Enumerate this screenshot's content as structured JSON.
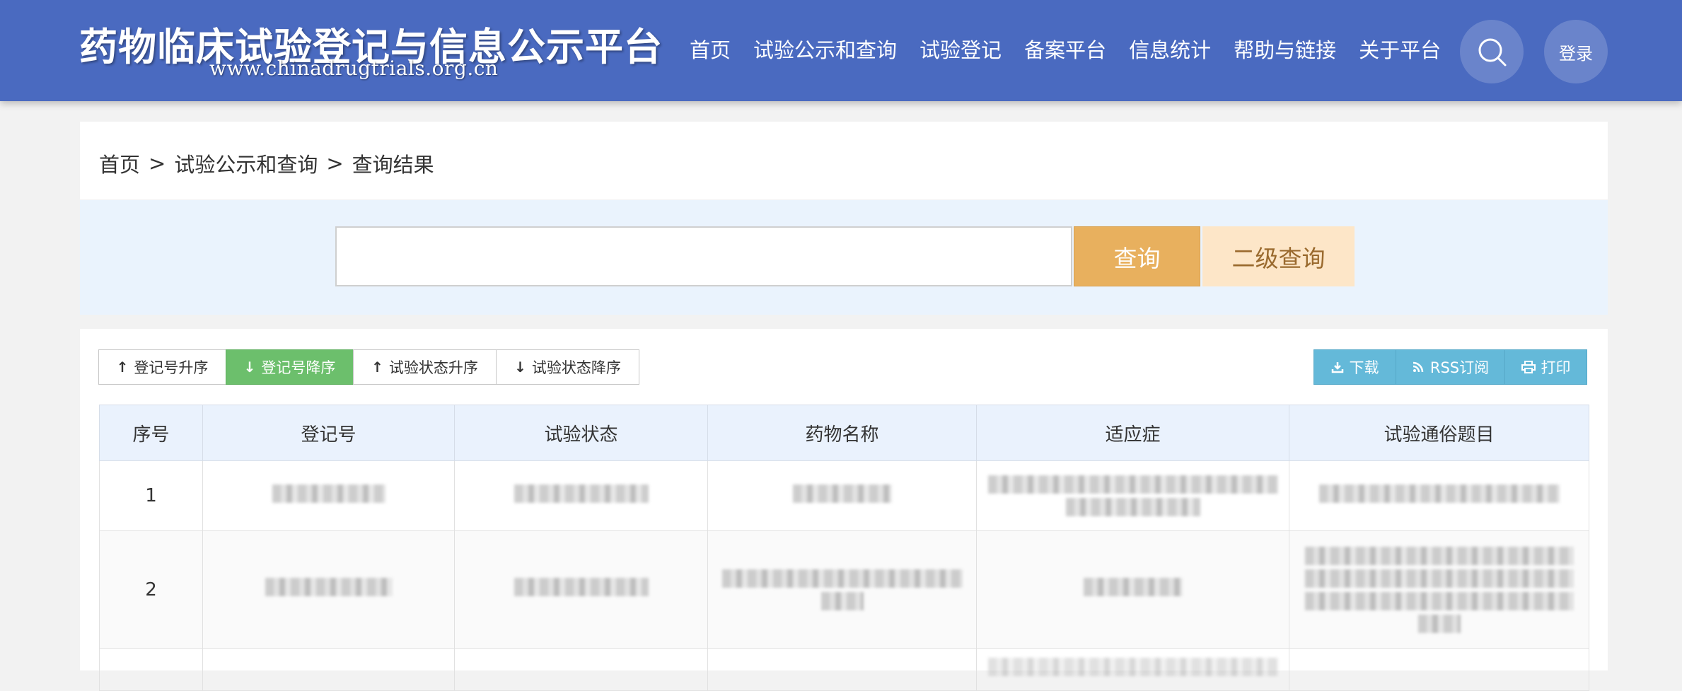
{
  "header": {
    "title": "药物临床试验登记与信息公示平台",
    "url_text": "www.chinadrugtrials.org.cn",
    "nav": [
      "首页",
      "试验公示和查询",
      "试验登记",
      "备案平台",
      "信息统计",
      "帮助与链接",
      "关于平台"
    ],
    "login_label": "登录",
    "search_icon": "search-icon"
  },
  "breadcrumb": {
    "home": "首页",
    "sep1": ">",
    "section": "试验公示和查询",
    "sep2": ">",
    "current": "查询结果"
  },
  "search": {
    "value": "",
    "query_label": "查询",
    "advanced_label": "二级查询"
  },
  "sort": {
    "buttons": [
      {
        "label": "登记号升序",
        "arrow": "↑",
        "active": false
      },
      {
        "label": "登记号降序",
        "arrow": "↓",
        "active": true
      },
      {
        "label": "试验状态升序",
        "arrow": "↑",
        "active": false
      },
      {
        "label": "试验状态降序",
        "arrow": "↓",
        "active": false
      }
    ]
  },
  "actions": {
    "download": "下载",
    "rss": "RSS订阅",
    "print": "打印"
  },
  "table": {
    "headers": [
      "序号",
      "登记号",
      "试验状态",
      "药物名称",
      "适应症",
      "试验通俗题目"
    ],
    "rows": [
      {
        "index": "1"
      },
      {
        "index": "2"
      }
    ]
  },
  "colors": {
    "header_bg": "#4a6ac0",
    "query_btn": "#e8b05e",
    "advanced_btn": "#fde6c8",
    "active_sort": "#6cbf6c",
    "action_btn": "#64b9d9"
  }
}
